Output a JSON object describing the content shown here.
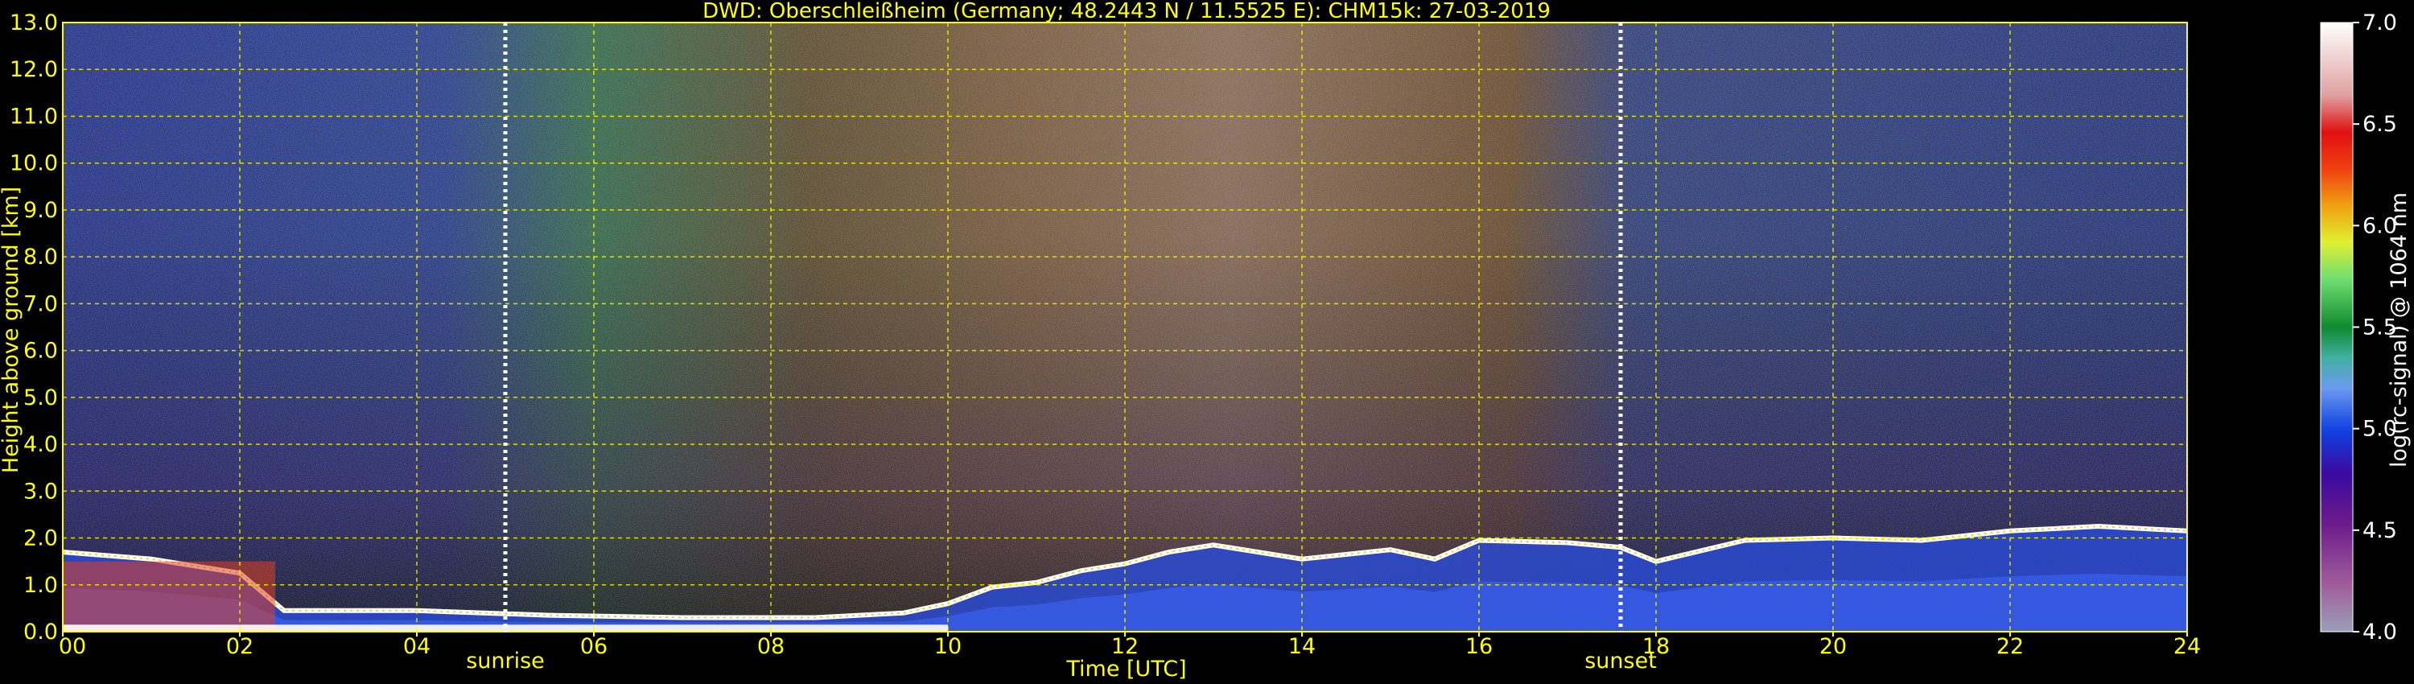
{
  "chart_data": {
    "type": "heatmap",
    "title": "DWD: Oberschleißheim (Germany; 48.2443 N / 11.5525 E):    CHM15k: 27-03-2019",
    "xlabel": "Time [UTC]",
    "ylabel": "Height above ground [km]",
    "xlim": [
      0,
      24
    ],
    "ylim": [
      0,
      13
    ],
    "x_ticks": [
      "00",
      "02",
      "04",
      "06",
      "08",
      "10",
      "12",
      "14",
      "16",
      "18",
      "20",
      "22",
      "24"
    ],
    "y_ticks": [
      "0.0",
      "1.0",
      "2.0",
      "3.0",
      "4.0",
      "5.0",
      "6.0",
      "7.0",
      "8.0",
      "9.0",
      "10.0",
      "11.0",
      "12.0",
      "13.0"
    ],
    "grid": true,
    "colorbar": {
      "label": "log(rc-signal) @ 1064 nm",
      "range": [
        4.0,
        7.0
      ],
      "ticks": [
        "4.0",
        "4.5",
        "5.0",
        "5.5",
        "6.0",
        "6.5",
        "7.0"
      ]
    },
    "events": [
      {
        "label": "sunrise",
        "time": 5.0
      },
      {
        "label": "sunset",
        "time": 17.6
      }
    ],
    "boundary_layer_top_km": {
      "time": [
        0,
        1,
        2,
        2.5,
        4,
        5.5,
        7,
        8.5,
        9.5,
        10,
        10.5,
        11,
        11.5,
        12,
        12.5,
        13,
        14,
        15,
        15.5,
        16,
        17,
        17.6,
        18,
        19,
        20,
        21,
        22,
        23,
        24
      ],
      "height": [
        1.7,
        1.55,
        1.25,
        0.45,
        0.45,
        0.35,
        0.3,
        0.3,
        0.4,
        0.6,
        0.95,
        1.05,
        1.3,
        1.45,
        1.7,
        1.85,
        1.55,
        1.75,
        1.55,
        1.95,
        1.9,
        1.8,
        1.5,
        1.95,
        2.0,
        1.95,
        2.15,
        2.25,
        2.15
      ]
    },
    "colors": {
      "text": "#ffff00",
      "grid": "#ffff00",
      "background": "#000000"
    }
  }
}
